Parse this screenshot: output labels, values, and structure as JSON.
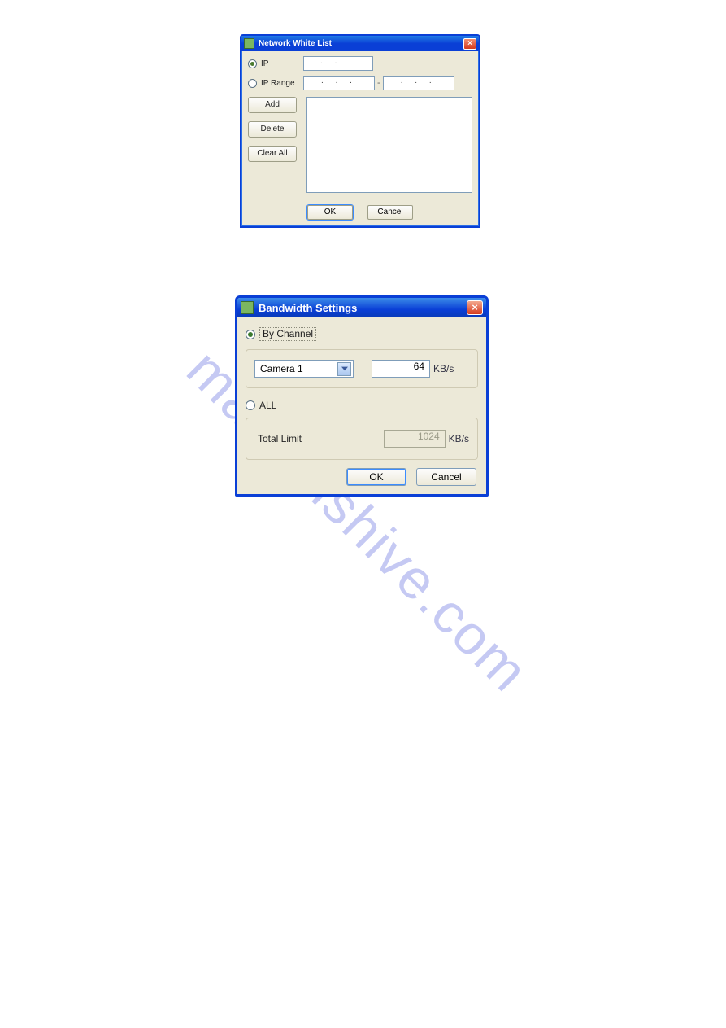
{
  "watermark": "manualshive.com",
  "whitelist": {
    "title": "Network White List",
    "close_glyph": "×",
    "mode_ip": {
      "label": "IP",
      "selected": true,
      "value": ".   .   ."
    },
    "mode_range": {
      "label": "IP Range",
      "selected": false,
      "from": ".   .   .",
      "to": ".   .   ."
    },
    "buttons": {
      "add": "Add",
      "delete": "Delete",
      "clear_all": "Clear All",
      "ok": "OK",
      "cancel": "Cancel"
    },
    "list_items": []
  },
  "bandwidth": {
    "title": "Bandwidth Settings",
    "close_glyph": "×",
    "mode_channel": {
      "label": "By Channel",
      "selected": true
    },
    "channel": {
      "selected": "Camera 1",
      "value": "64",
      "unit": "KB/s"
    },
    "mode_all": {
      "label": "ALL",
      "selected": false
    },
    "total": {
      "label": "Total Limit",
      "value": "1024",
      "unit": "KB/s"
    },
    "buttons": {
      "ok": "OK",
      "cancel": "Cancel"
    }
  }
}
